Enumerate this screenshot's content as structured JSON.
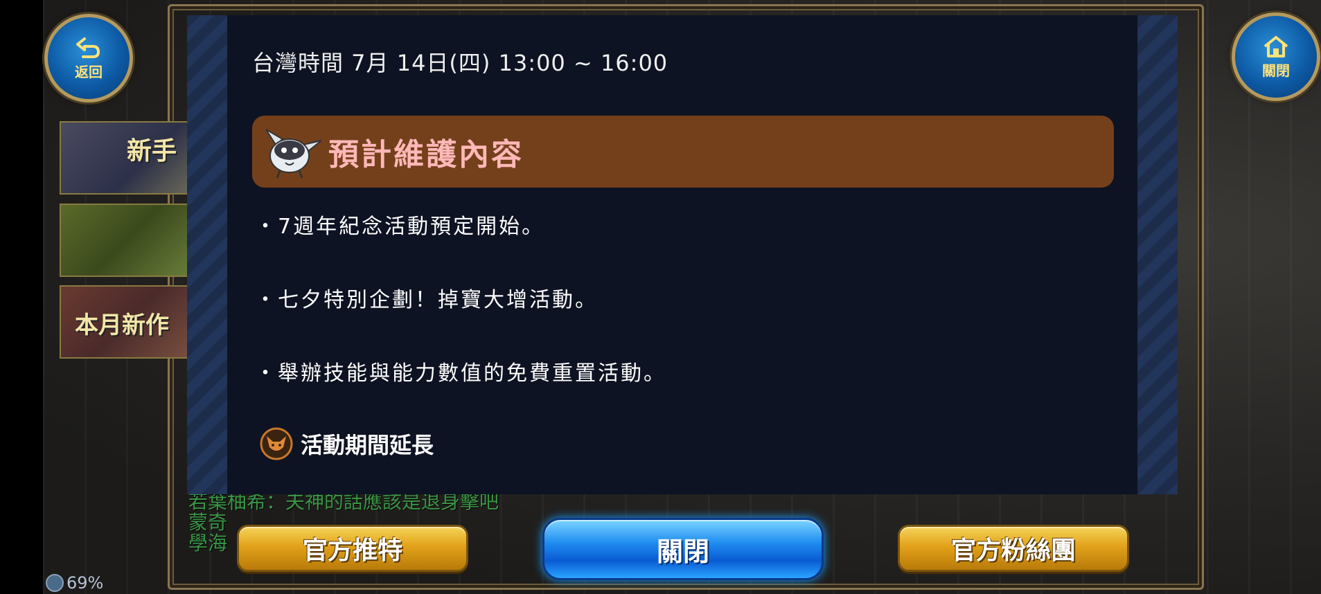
{
  "nav": {
    "back_label": "返回",
    "close_top_label": "關閉"
  },
  "banners": [
    {
      "text": "新手"
    },
    {
      "text": ""
    },
    {
      "text": "本月新作"
    }
  ],
  "dialog": {
    "date_line": "台灣時間 7月 14日(四) 13:00 ~ 16:00",
    "section_title": "預計維護內容",
    "bullets": [
      "・7週年紀念活動預定開始。",
      "・七夕特別企劃！掉寶大增活動。",
      "・舉辦技能與能力數值的免費重置活動。"
    ],
    "sub_title": "活動期間延長"
  },
  "chat": {
    "lines": [
      "若葉柚希：夫神的話應該是退身擊吧",
      "蒙奇",
      "學海"
    ]
  },
  "buttons": {
    "twitter": "官方推特",
    "close": "關閉",
    "fanpage": "官方粉絲團"
  },
  "status": {
    "battery": "69%"
  },
  "colors": {
    "section_bg": "#74401c",
    "section_title": "#ffb8b8",
    "dialog_bg": "#0d1322",
    "gold_button": "#e2a21a",
    "blue_button": "#1e8cf0"
  }
}
